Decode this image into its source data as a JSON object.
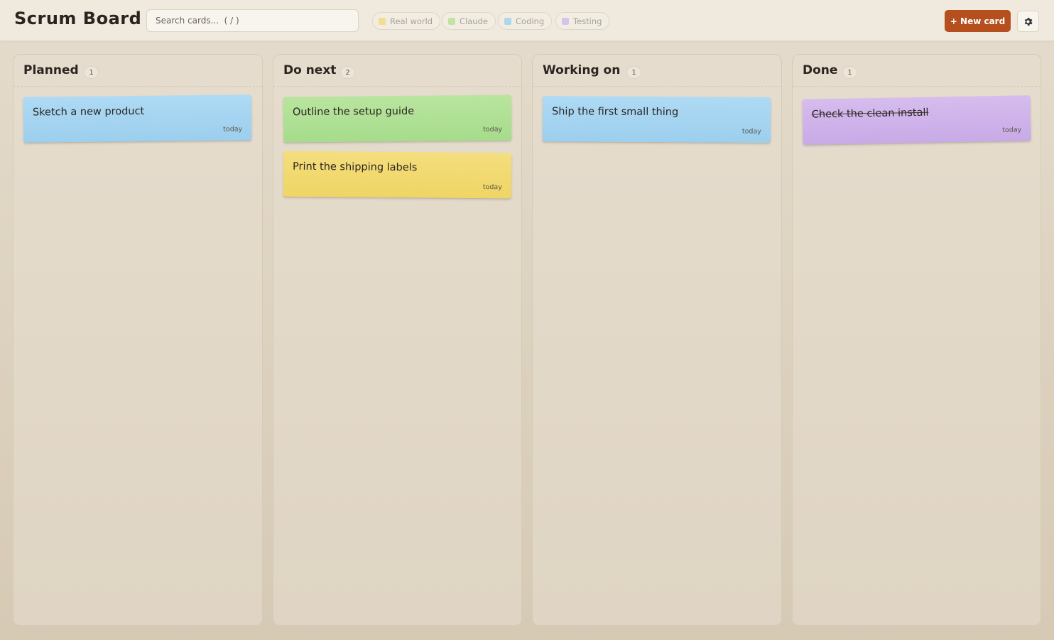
{
  "app": {
    "title": "Scrum Board"
  },
  "search": {
    "placeholder": "Search cards...  ( / )"
  },
  "filters": [
    {
      "label": "Real world",
      "color": "#f1de8e"
    },
    {
      "label": "Claude",
      "color": "#c3e2a6"
    },
    {
      "label": "Coding",
      "color": "#add8ec"
    },
    {
      "label": "Testing",
      "color": "#d7c4ea"
    }
  ],
  "actions": {
    "new_card": "+ New card",
    "settings_icon": "gear-icon"
  },
  "colors": {
    "accent": "#b5501e",
    "blue": "#a6d5f1",
    "green": "#b2e196",
    "yellow": "#f1d974",
    "purple": "#d1b5ea"
  },
  "columns": [
    {
      "title": "Planned",
      "count": "1",
      "cards": [
        {
          "title": "Sketch a new product",
          "date": "today",
          "color": "blue"
        }
      ]
    },
    {
      "title": "Do next",
      "count": "2",
      "cards": [
        {
          "title": "Outline the setup guide",
          "date": "today",
          "color": "green"
        },
        {
          "title": "Print the shipping labels",
          "date": "today",
          "color": "yellow"
        }
      ]
    },
    {
      "title": "Working on",
      "count": "1",
      "cards": [
        {
          "title": "Ship the first small thing",
          "date": "today",
          "color": "blue"
        }
      ]
    },
    {
      "title": "Done",
      "count": "1",
      "cards": [
        {
          "title": "Check the clean install",
          "date": "today",
          "color": "purple",
          "done": true
        }
      ]
    }
  ]
}
